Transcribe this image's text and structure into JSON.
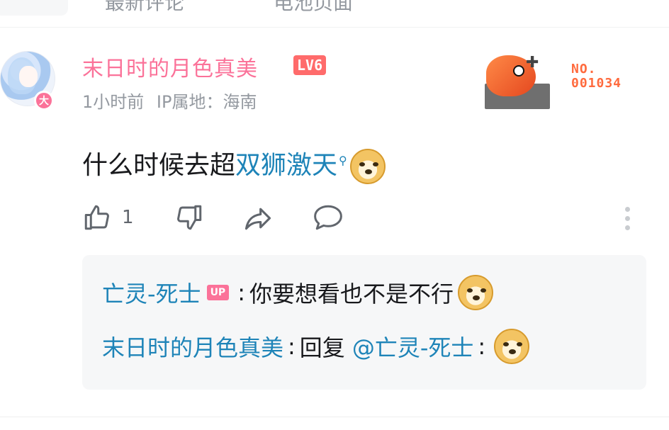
{
  "topbar": {
    "ghost_left": "最新评论",
    "ghost_right": "电池页面"
  },
  "comment": {
    "username": "末日时的月色真美",
    "level": "LV6",
    "vip_badge": "大",
    "time": "1小时前",
    "ip_label": "IP属地：海南",
    "fan_no": "NO.\n001034",
    "content_prefix": "什么时候去超",
    "content_link": "双狮激天",
    "likes": "1"
  },
  "replies": [
    {
      "name": "亡灵-死士",
      "tag": "UP",
      "text": "你要想看也不是不行"
    },
    {
      "name": "末日时的月色真美",
      "text": "回复",
      "mention": "@亡灵-死士"
    }
  ],
  "icons": {
    "emoji": "doge-emoji",
    "search": "search-icon",
    "like": "thumbs-up-icon",
    "dislike": "thumbs-down-icon",
    "share": "share-icon",
    "comment": "comment-icon",
    "more": "more-vertical-icon"
  },
  "colors": {
    "pink": "#fb7299",
    "link_blue": "#1e84b8",
    "muted": "#9499a0",
    "reply_bg": "#f6f7f8"
  }
}
